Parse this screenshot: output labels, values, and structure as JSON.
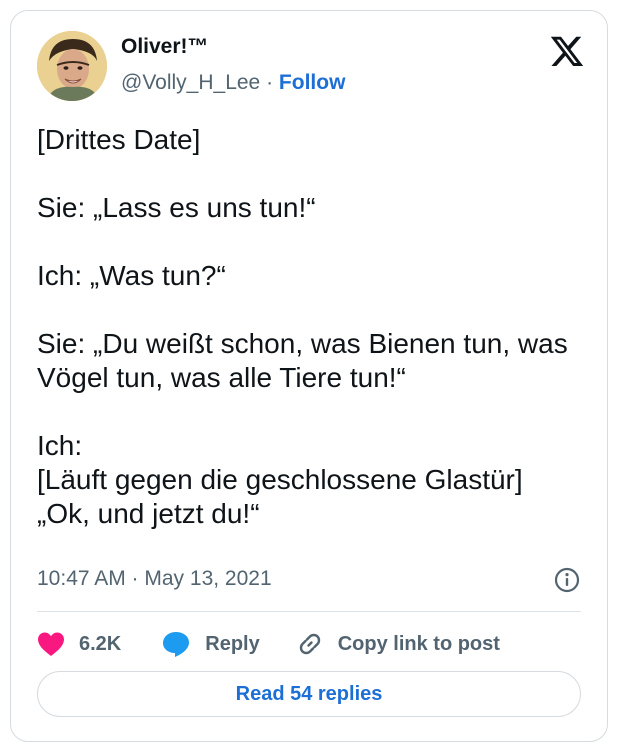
{
  "author": {
    "name": "Oliver!™",
    "handle": "@Volly_H_Lee",
    "separator": " · ",
    "follow_label": "Follow"
  },
  "tweet": {
    "text": "[Drittes Date]\n\nSie: „Lass es uns tun!“\n\nIch: „Was tun?“\n\nSie: „Du weißt schon, was Bienen tun, was Vögel tun, was alle Tiere tun!“\n\nIch:\n[Läuft gegen die geschlossene Glastür]\n„Ok, und jetzt du!“",
    "timestamp": "10:47 AM · May 13, 2021"
  },
  "actions": {
    "likes_count": "6.2K",
    "reply_label": "Reply",
    "copy_link_label": "Copy link to post",
    "read_replies_label": "Read 54 replies"
  },
  "colors": {
    "heart": "#f91880",
    "reply_bubble": "#1d9bf0",
    "link": "#1d6fd6",
    "muted": "#536471"
  },
  "icons": [
    "x-logo-icon",
    "info-icon",
    "heart-icon",
    "reply-bubble-icon",
    "link-icon"
  ]
}
